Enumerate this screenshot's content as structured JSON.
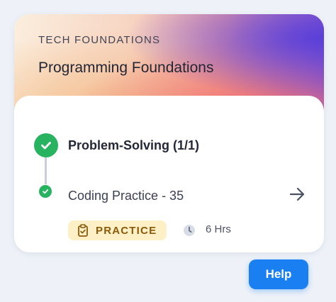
{
  "course": {
    "category": "TECH FOUNDATIONS",
    "title": "Programming Foundations"
  },
  "module": {
    "title": "Problem-Solving (1/1)",
    "status_icon": "check-circle-icon"
  },
  "item": {
    "title": "Coding Practice - 35",
    "status_icon": "check-circle-icon",
    "action_icon": "arrow-right-icon",
    "tag_label": "PRACTICE",
    "tag_icon": "clipboard-check-icon",
    "duration_icon": "clock-icon",
    "duration": "6 Hrs"
  },
  "help": {
    "label": "Help"
  },
  "colors": {
    "success": "#27b35f",
    "tag_bg": "#fdf0c7",
    "tag_text": "#8a5a08",
    "primary": "#1a7ff0"
  }
}
